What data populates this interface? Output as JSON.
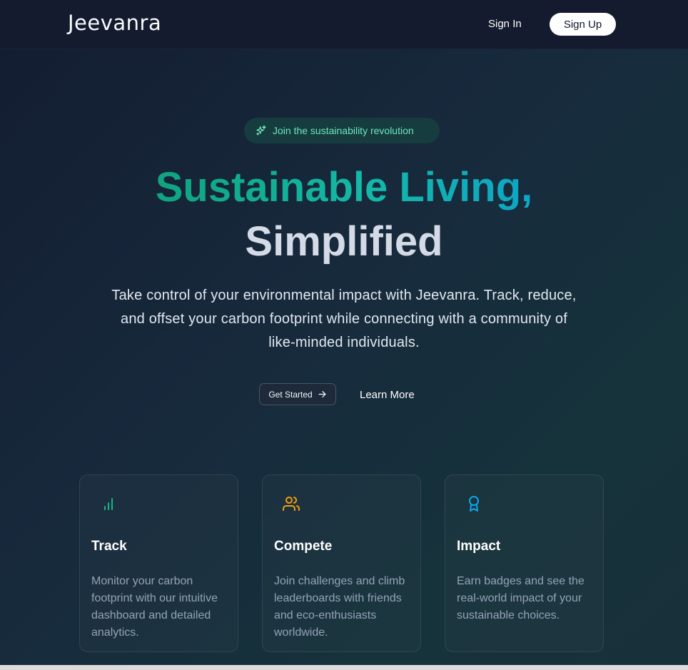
{
  "header": {
    "brand": "Jeevanra",
    "sign_in": "Sign In",
    "sign_up": "Sign Up"
  },
  "hero": {
    "badge_text": "Join the sustainability revolution",
    "badge_icon": "sparkles-icon",
    "headline_line1": "Sustainable Living,",
    "headline_line2": "Simplified",
    "subtitle": "Take control of your environmental impact with Jeevanra. Track, reduce, and offset your carbon footprint while connecting with a community of like-minded individuals.",
    "primary_button": "Get Started",
    "primary_button_icon": "arrow-right-icon",
    "secondary_button": "Learn More"
  },
  "features": [
    {
      "icon": "bar-chart-icon",
      "icon_color": "#10b981",
      "title": "Track",
      "description": "Monitor your carbon footprint with our intuitive dashboard and detailed analytics."
    },
    {
      "icon": "users-icon",
      "icon_color": "#f59e0b",
      "title": "Compete",
      "description": "Join challenges and climb leaderboards with friends and eco-enthusiasts worldwide."
    },
    {
      "icon": "award-icon",
      "icon_color": "#0ea5e9",
      "title": "Impact",
      "description": "Earn badges and see the real-world impact of your sustainable choices."
    }
  ],
  "colors": {
    "accent_green": "#10a37f",
    "accent_teal": "#0ea5c6",
    "background": "#131c31"
  }
}
